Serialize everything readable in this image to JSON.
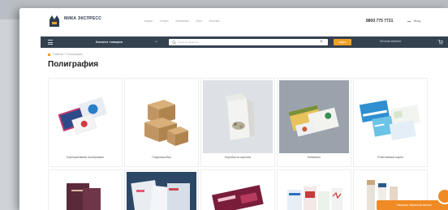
{
  "header": {
    "logo_text": "МИКА ЭКСПРЕСС",
    "logo_sub": "",
    "nav": [
      "Акции",
      "Услуги",
      "Компании",
      "Блог",
      "Контакт"
    ],
    "phone": "8800 775 7731",
    "login": "Вход"
  },
  "navbar": {
    "catalog_label": "Каталог товаров",
    "search_placeholder": "Поиск по каталогу",
    "find_label": "Найти",
    "cabinet_label": "Личный кабинет"
  },
  "breadcrumb": "Главная / Полиграфия",
  "page_title": "Полиграфия",
  "products": [
    {
      "name": "Корпоративная полиграфия"
    },
    {
      "name": "Гофрокоробки"
    },
    {
      "name": "Коробка из картона"
    },
    {
      "name": "Конверты"
    },
    {
      "name": "Пластиковые карты"
    },
    {
      "name": ""
    },
    {
      "name": ""
    },
    {
      "name": ""
    },
    {
      "name": ""
    },
    {
      "name": ""
    }
  ],
  "callback_label": "Заказать обратный звонок",
  "colors": {
    "nav_bg": "#34414f",
    "accent": "#f0a025",
    "callback": "#f08a24"
  }
}
